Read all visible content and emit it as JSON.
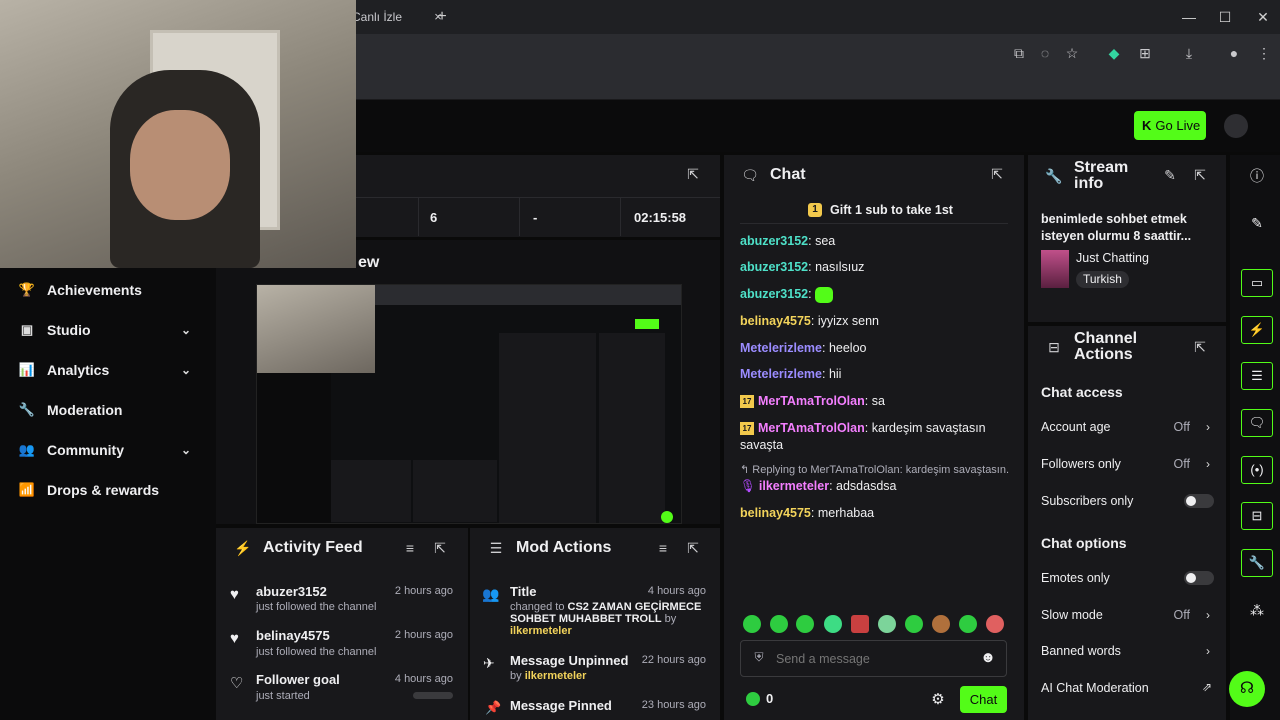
{
  "browser": {
    "tab_label": "Canlı İzle",
    "close_glyph": "×",
    "new_tab_glyph": "+",
    "window_controls": [
      "—",
      "☐",
      "✕"
    ]
  },
  "topbar": {
    "go_live_label": "Go Live",
    "go_live_glyph": "K"
  },
  "nav": {
    "items": [
      {
        "label": "Achievements",
        "icon": "trophy-icon",
        "glyph": "🏆",
        "chevron": ""
      },
      {
        "label": "Studio",
        "icon": "studio-icon",
        "glyph": "▣",
        "chevron": "⌄"
      },
      {
        "label": "Analytics",
        "icon": "analytics-icon",
        "glyph": "📊",
        "chevron": "⌄"
      },
      {
        "label": "Moderation",
        "icon": "wrench-icon",
        "glyph": "🔧",
        "chevron": ""
      },
      {
        "label": "Community",
        "icon": "community-icon",
        "glyph": "👥",
        "chevron": "⌄"
      },
      {
        "label": "Drops & rewards",
        "icon": "drops-icon",
        "glyph": "📶",
        "chevron": ""
      }
    ]
  },
  "stats": {
    "viewers": "6",
    "followers": "-",
    "uptime": "02:15:58"
  },
  "preview": {
    "title_fragment": "ew"
  },
  "activity": {
    "title": "Activity Feed",
    "items": [
      {
        "name": "abuzer3152",
        "sub": "just followed the channel",
        "time": "2 hours ago"
      },
      {
        "name": "belinay4575",
        "sub": "just followed the channel",
        "time": "2 hours ago"
      },
      {
        "name": "Follower goal",
        "sub": "just started",
        "time": "4 hours ago"
      }
    ]
  },
  "mod": {
    "title": "Mod Actions",
    "items": [
      {
        "title": "Title",
        "time": "4 hours ago",
        "detail_prefix": "changed to ",
        "detail_bold": "CS2 ZAMAN GEÇİRMECE SOHBET MUHABBET TROLL",
        "detail_suffix": " by",
        "by": "ilkermeteler"
      },
      {
        "title": "Message Unpinned",
        "time": "22 hours ago",
        "detail_prefix": "by ",
        "by": "ilkermeteler"
      },
      {
        "title": "Message Pinned",
        "time": "23 hours ago"
      }
    ]
  },
  "chat": {
    "title": "Chat",
    "gift_label": "Gift 1 sub to take 1st",
    "messages": [
      {
        "user": "abuzer3152",
        "color": "#4ee0c8",
        "text": "sea"
      },
      {
        "user": "abuzer3152",
        "color": "#4ee0c8",
        "text": "nasılsıuz"
      },
      {
        "user": "abuzer3152",
        "color": "#4ee0c8",
        "text": ""
      },
      {
        "user": "belinay4575",
        "color": "#f2d35b",
        "text": "iyyizx senn"
      },
      {
        "user": "Metelerizleme",
        "color": "#9b8cff",
        "text": "heeloo"
      },
      {
        "user": "Metelerizleme",
        "color": "#9b8cff",
        "text": "hii"
      },
      {
        "user": "MerTAmaTrolOlan",
        "color": "#f47fff",
        "text": "sa",
        "badge": "17"
      },
      {
        "user": "MerTAmaTrolOlan",
        "color": "#f47fff",
        "text": "kardeşim savaştasın savaşta",
        "badge": "17"
      }
    ],
    "reply_hint": "Replying to MerTAmaTrolOlan: kardeşim savaştasın...",
    "messages2": [
      {
        "user": "ilkermeteler",
        "color": "#f47fff",
        "text": "adsdasdsa"
      },
      {
        "user": "belinay4575",
        "color": "#f2d35b",
        "text": "merhabaa"
      }
    ],
    "input_placeholder": "Send a message",
    "points": "0",
    "send_label": "Chat"
  },
  "stream_info": {
    "title": "Stream info",
    "stream_title": "benimlede sohbet etmek isteyen olurmu 8 saattir...",
    "category": "Just Chatting",
    "language": "Turkish"
  },
  "channel_actions": {
    "title": "Channel Actions",
    "chat_access_heading": "Chat access",
    "account_age": {
      "label": "Account age",
      "value": "Off"
    },
    "followers_only": {
      "label": "Followers only",
      "value": "Off"
    },
    "subscribers_only": {
      "label": "Subscribers only"
    },
    "chat_options_heading": "Chat options",
    "emotes_only": {
      "label": "Emotes only"
    },
    "slow_mode": {
      "label": "Slow mode",
      "value": "Off"
    },
    "banned_words": {
      "label": "Banned words"
    },
    "ai_moderation": {
      "label": "AI Chat Moderation"
    }
  },
  "colors": {
    "accent": "#53fc18",
    "panel": "#18181b",
    "background": "#0a0a0a"
  }
}
